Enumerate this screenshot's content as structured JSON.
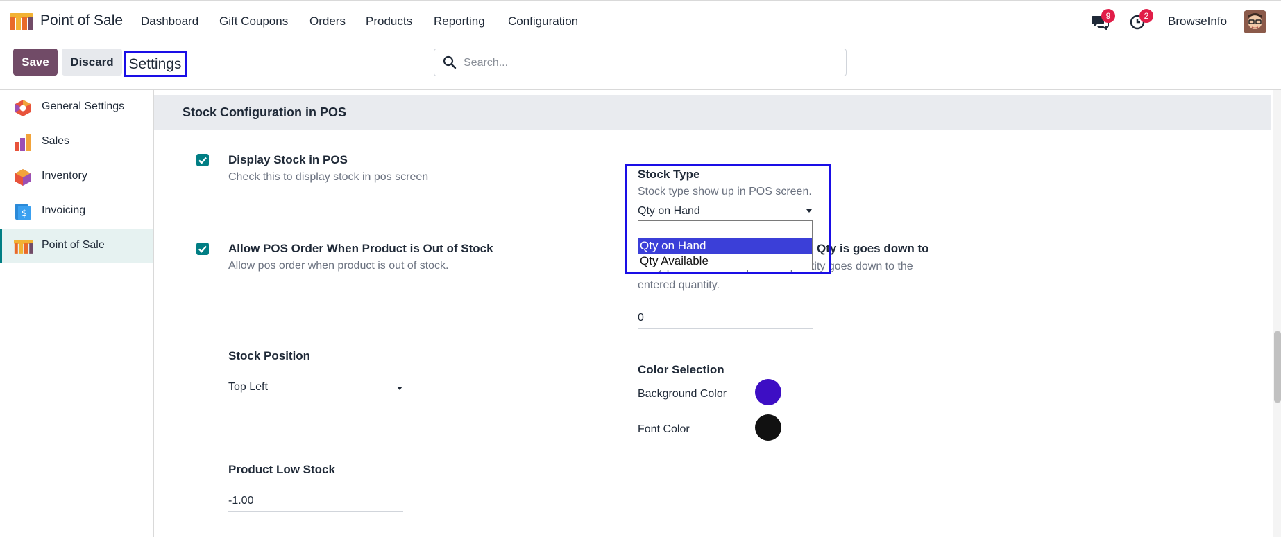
{
  "navbar": {
    "app_name": "Point of Sale",
    "menu": [
      "Dashboard",
      "Gift Coupons",
      "Orders",
      "Products",
      "Reporting",
      "Configuration"
    ],
    "messages_count": "9",
    "activities_count": "2",
    "user_name": "BrowseInfo"
  },
  "control_panel": {
    "save_label": "Save",
    "discard_label": "Discard",
    "breadcrumb": "Settings",
    "search_placeholder": "Search..."
  },
  "sidebar": {
    "items": [
      {
        "label": "General Settings",
        "icon": "general-settings-icon"
      },
      {
        "label": "Sales",
        "icon": "sales-icon"
      },
      {
        "label": "Inventory",
        "icon": "inventory-icon"
      },
      {
        "label": "Invoicing",
        "icon": "invoicing-icon"
      },
      {
        "label": "Point of Sale",
        "icon": "point-of-sale-icon",
        "active": true
      }
    ]
  },
  "section": {
    "title": "Stock Configuration in POS",
    "display_stock": {
      "label": "Display Stock in POS",
      "desc": "Check this to display stock in pos screen",
      "checked": true
    },
    "allow_order": {
      "label": "Allow POS Order When Product is Out of Stock",
      "desc": "Allow pos order when product is out of stock.",
      "checked": true
    },
    "stock_type": {
      "label": "Stock Type",
      "desc": "Stock type show up in POS screen.",
      "value": "Qty on Hand",
      "options": [
        "Qty on Hand",
        "Qty Available"
      ]
    },
    "deny_order": {
      "label_visible": "Qty is goes down to",
      "desc_line1": "Deny pos order when product quantity goes down to the",
      "desc_line2": "entered quantity.",
      "value": "0"
    },
    "stock_position": {
      "label": "Stock Position",
      "value": "Top Left"
    },
    "color_selection": {
      "label": "Color Selection",
      "background_label": "Background Color",
      "background_color": "#3d0ec4",
      "font_label": "Font Color",
      "font_color": "#111111"
    },
    "low_stock": {
      "label": "Product Low Stock",
      "value": "-1.00"
    }
  },
  "colors": {
    "brand": "#714b67",
    "accent": "#017e84",
    "highlight_box": "#1a0ee6",
    "dropdown_selected": "#3b3fd8"
  }
}
